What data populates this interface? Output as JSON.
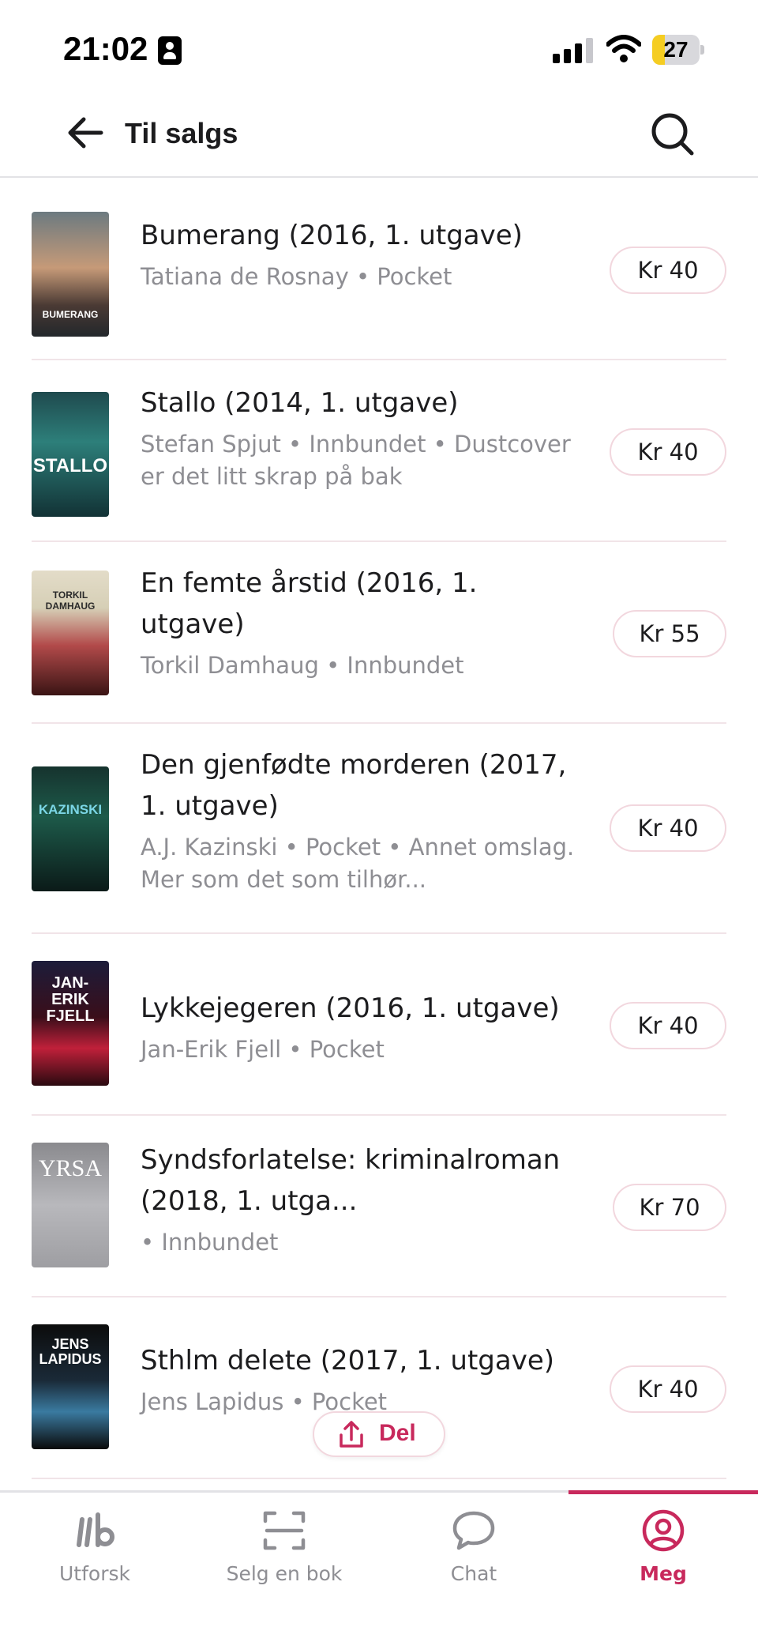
{
  "status_bar": {
    "time": "21:02",
    "battery": "27",
    "battery_level": 0.27
  },
  "header": {
    "title": "Til salgs",
    "back_icon": "arrow-left-icon",
    "search_icon": "search-icon"
  },
  "books": [
    {
      "title": "Bumerang (2016, 1. utgave)",
      "meta": "Tatiana de Rosnay • Pocket",
      "price": "Kr 40",
      "cover_text": "BUMERANG"
    },
    {
      "title": "Stallo (2014, 1. utgave)",
      "meta": "Stefan Spjut • Innbundet • Dustcover er det litt skrap på bak",
      "price": "Kr 40",
      "cover_text": "STALLO"
    },
    {
      "title": "En femte årstid (2016, 1. utgave)",
      "meta": "Torkil Damhaug • Innbundet",
      "price": "Kr 55",
      "cover_text": "TORKIL DAMHAUG"
    },
    {
      "title": "Den gjenfødte morderen (2017, 1. utgave)",
      "meta": "A.J. Kazinski • Pocket • Annet omslag. Mer som det som tilhør...",
      "price": "Kr 40",
      "cover_text": "KAZINSKI"
    },
    {
      "title": "Lykkejegeren (2016, 1. utgave)",
      "meta": "Jan-Erik Fjell • Pocket",
      "price": "Kr 40",
      "cover_text": "JAN-ERIK FJELL"
    },
    {
      "title": "Syndsforlatelse: kriminalroman (2018, 1. utga...",
      "meta": " • Innbundet",
      "price": "Kr 70",
      "cover_text": "YRSA"
    },
    {
      "title": "Sthlm delete (2017, 1. utgave)",
      "meta": "Jens Lapidus • Pocket",
      "price": "Kr 40",
      "cover_text": "JENS LAPIDUS"
    }
  ],
  "share": {
    "label": "Del",
    "icon": "share-icon"
  },
  "nav": {
    "items": [
      {
        "label": "Utforsk",
        "icon": "lb-logo-icon"
      },
      {
        "label": "Selg en bok",
        "icon": "scan-icon"
      },
      {
        "label": "Chat",
        "icon": "chat-bubble-icon"
      },
      {
        "label": "Meg",
        "icon": "user-circle-icon",
        "active": true
      }
    ]
  },
  "colors": {
    "accent": "#c8295c",
    "muted_text": "#8e8e93",
    "divider": "#f1e4e8"
  }
}
